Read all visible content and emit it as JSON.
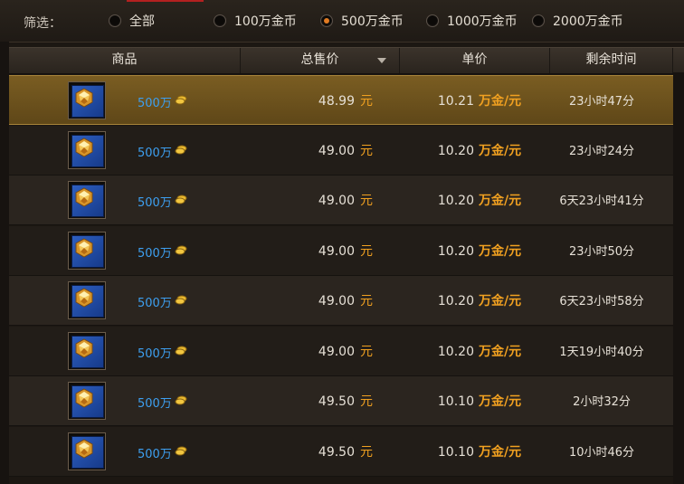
{
  "filter": {
    "label": "筛选：",
    "options": [
      {
        "label": "全部",
        "selected": false
      },
      {
        "label": "100万金币",
        "selected": false
      },
      {
        "label": "500万金币",
        "selected": true
      },
      {
        "label": "1000万金币",
        "selected": false
      },
      {
        "label": "2000万金币",
        "selected": false
      }
    ]
  },
  "columns": {
    "item": "商品",
    "total_price": "总售价",
    "unit_price": "单价",
    "time_left": "剩余时间"
  },
  "currency_unit": "元",
  "rate_unit": "万金/元",
  "colors": {
    "accent_gold": "#f0a020",
    "quantity_blue": "#3d9ff0",
    "selected_row": "#7a5d22"
  },
  "rows": [
    {
      "qty": "500万",
      "total": "48.99",
      "rate": "10.21",
      "time": "23小时47分",
      "selected": true
    },
    {
      "qty": "500万",
      "total": "49.00",
      "rate": "10.20",
      "time": "23小时24分",
      "selected": false
    },
    {
      "qty": "500万",
      "total": "49.00",
      "rate": "10.20",
      "time": "6天23小时41分",
      "selected": false
    },
    {
      "qty": "500万",
      "total": "49.00",
      "rate": "10.20",
      "time": "23小时50分",
      "selected": false
    },
    {
      "qty": "500万",
      "total": "49.00",
      "rate": "10.20",
      "time": "6天23小时58分",
      "selected": false
    },
    {
      "qty": "500万",
      "total": "49.00",
      "rate": "10.20",
      "time": "1天19小时40分",
      "selected": false
    },
    {
      "qty": "500万",
      "total": "49.50",
      "rate": "10.10",
      "time": "2小时32分",
      "selected": false
    },
    {
      "qty": "500万",
      "total": "49.50",
      "rate": "10.10",
      "time": "10小时46分",
      "selected": false
    }
  ]
}
